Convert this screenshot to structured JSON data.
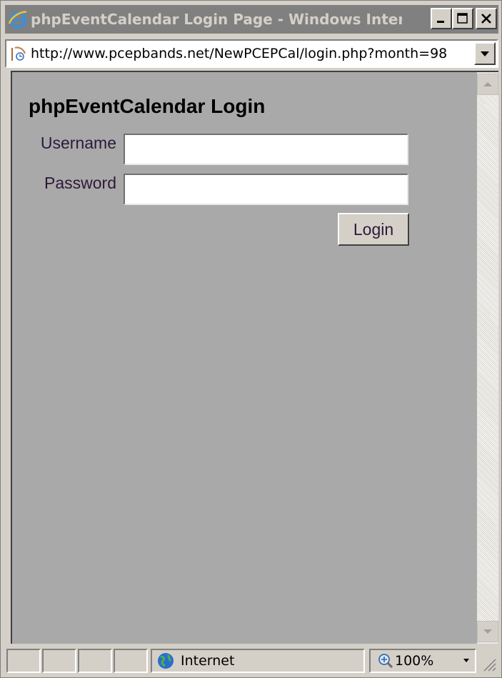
{
  "window": {
    "title": "phpEventCalendar Login Page - Windows Inter...",
    "controls": {
      "minimize_icon": "minimize-icon",
      "maximize_icon": "maximize-icon",
      "close_icon": "close-icon"
    }
  },
  "address_bar": {
    "url": "http://www.pcepbands.net/NewPCEPCal/login.php?month=98"
  },
  "page": {
    "heading": "phpEventCalendar Login",
    "username_label": "Username",
    "username_value": "",
    "password_label": "Password",
    "password_value": "",
    "login_button": "Login",
    "background_color": "#a9a9a9"
  },
  "status_bar": {
    "zone": "Internet",
    "zoom": "100%"
  }
}
